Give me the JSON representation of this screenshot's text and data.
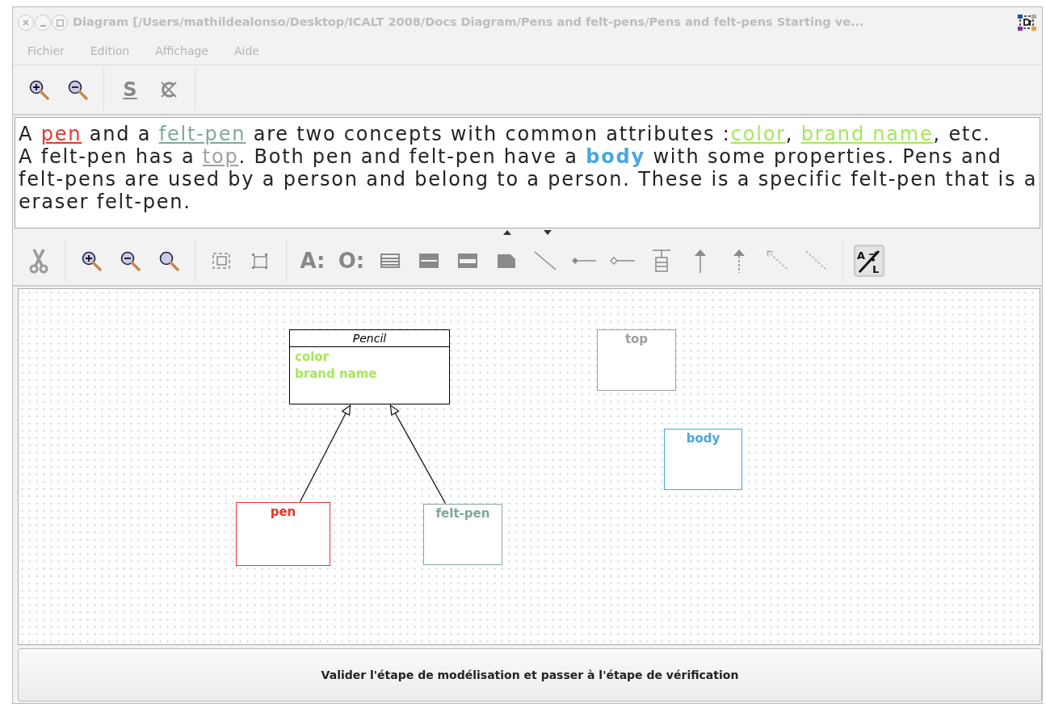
{
  "window": {
    "title": "Diagram [/Users/mathildealonso/Desktop/ICALT 2008/Docs Diagram/Pens and felt-pens/Pens and felt-pens Starting ve..."
  },
  "menu": [
    {
      "label": "Fichier",
      "disabled": true
    },
    {
      "label": "Edition",
      "disabled": true
    },
    {
      "label": "Affichage",
      "disabled": true
    },
    {
      "label": "Aide",
      "disabled": true
    }
  ],
  "toolbar_top": {
    "underline_tool": "S"
  },
  "description": {
    "lines": [
      [
        {
          "text": "A ",
          "kind": "plain"
        },
        {
          "text": "pen",
          "kind": "term",
          "underlined": true,
          "color": "#e8352a"
        },
        {
          "text": " and a ",
          "kind": "plain"
        },
        {
          "text": "felt-pen",
          "kind": "term",
          "underlined": true,
          "color": "#7fa89a"
        },
        {
          "text": " are two concepts with common attributes :",
          "kind": "plain"
        },
        {
          "text": "color",
          "kind": "term",
          "underlined": true,
          "color": "#a6e85a"
        },
        {
          "text": ", ",
          "kind": "plain"
        },
        {
          "text": "brand name",
          "kind": "term",
          "underlined": true,
          "color": "#a6e85a"
        },
        {
          "text": ", etc.",
          "kind": "plain"
        }
      ],
      [
        {
          "text": "A felt-pen has a ",
          "kind": "plain"
        },
        {
          "text": "top",
          "kind": "term",
          "underlined": true,
          "color": "#a0a0a0"
        },
        {
          "text": ". Both pen and felt-pen have a ",
          "kind": "plain"
        },
        {
          "text": "body",
          "kind": "term",
          "underlined": false,
          "color": "#4aa8dc"
        },
        {
          "text": " with some properties. Pens and",
          "kind": "plain"
        }
      ],
      [
        {
          "text": "felt-pens are used by a person and belong to a person. These is a specific felt-pen that is a",
          "kind": "plain"
        }
      ],
      [
        {
          "text": "eraser felt-pen.",
          "kind": "plain"
        }
      ]
    ]
  },
  "toolbar_diagram": {
    "attribute_tool": "A:",
    "object_tool": "O:",
    "auto_layout": {
      "top": "A",
      "bottom": "L",
      "selected": true
    }
  },
  "diagram": {
    "classes": [
      {
        "name": "Pencil",
        "kind": "abstract",
        "color": "#000000",
        "attributes": [
          {
            "name": "color",
            "color": "#a6e85a"
          },
          {
            "name": "brand name",
            "color": "#a6e85a"
          }
        ],
        "children": [
          {
            "name": "pen",
            "kind": "concept",
            "color": "#e8352a"
          },
          {
            "name": "felt-pen",
            "kind": "concept",
            "color": "#7fa89a"
          }
        ]
      },
      {
        "name": "top",
        "kind": "concept",
        "color": "#a0a0a0"
      },
      {
        "name": "body",
        "kind": "concept",
        "color": "#4aa8dc"
      }
    ]
  },
  "validate_button": "Valider l'étape de modélisation et passer à l'étape de vérification"
}
